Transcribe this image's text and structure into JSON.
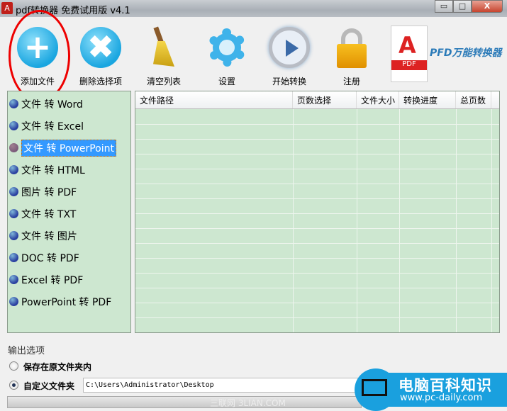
{
  "window": {
    "title": "pdf转换器 免费试用版 v4.1",
    "minimize": "▭",
    "maximize": "□",
    "close": "X"
  },
  "toolbar": [
    {
      "label": "添加文件",
      "icon": "plus-icon"
    },
    {
      "label": "删除选择项",
      "icon": "x-icon"
    },
    {
      "label": "清空列表",
      "icon": "broom-icon"
    },
    {
      "label": "设置",
      "icon": "gear-icon"
    },
    {
      "label": "开始转换",
      "icon": "play-icon"
    },
    {
      "label": "注册",
      "icon": "lock-icon"
    }
  ],
  "brand": {
    "badge": "PDF",
    "text": "PFD万能转换器"
  },
  "modes": {
    "selected": 2,
    "items": [
      "文件 转 Word",
      "文件 转 Excel",
      "文件 转 PowerPoint",
      "文件 转 HTML",
      "图片 转 PDF",
      "文件 转 TXT",
      "文件 转 图片",
      "DOC 转 PDF",
      "Excel 转 PDF",
      "PowerPoint 转 PDF"
    ]
  },
  "table": {
    "columns": [
      "文件路径",
      "页数选择",
      "文件大小",
      "转换进度",
      "总页数"
    ],
    "rows": []
  },
  "output": {
    "title": "输出选项",
    "option1": "保存在原文件夹内",
    "option2": "自定义文件夹",
    "selected": "自定义文件夹",
    "path": "C:\\Users\\Administrator\\Desktop"
  },
  "watermark": {
    "title": "电脑百科知识",
    "url": "www.pc-daily.com",
    "faint": "三联网 3LIAN.COM"
  }
}
